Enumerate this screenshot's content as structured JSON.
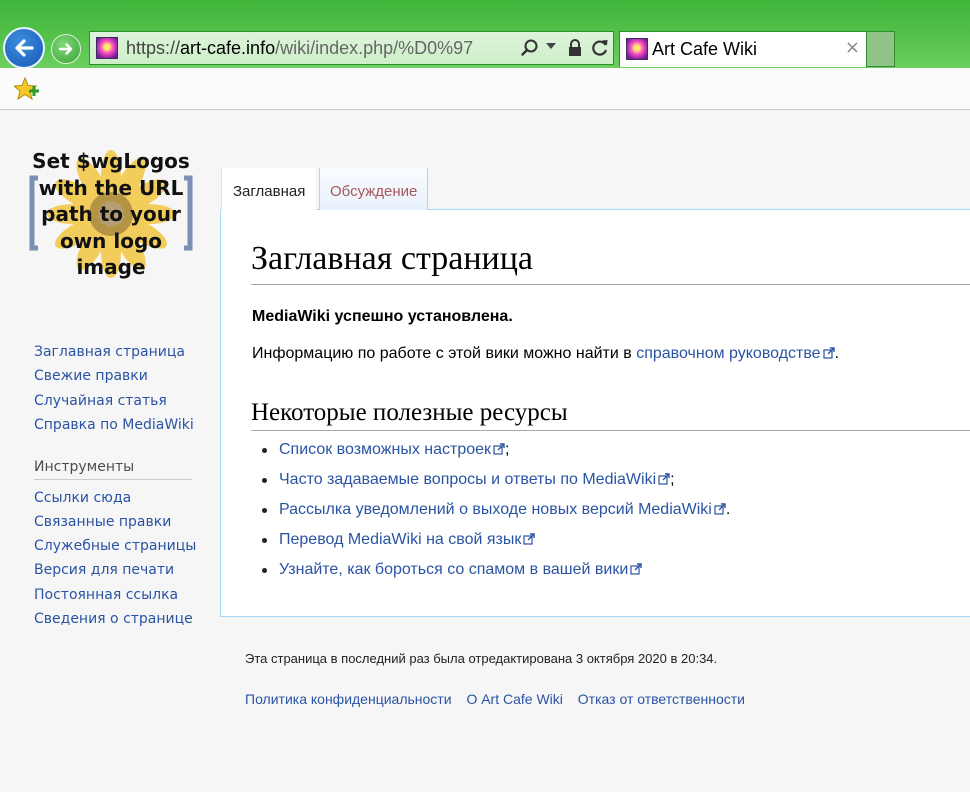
{
  "browser": {
    "url_prefix": "https://",
    "url_host": "art-cafe.info",
    "url_rest": "/wiki/index.php/%D0%97",
    "tab_title": "Art Cafe Wiki",
    "tab_close": "×",
    "accent": "#3fb53a"
  },
  "logo": {
    "lines": [
      "Set $wgLogos",
      "with the URL",
      "path to your",
      "own logo",
      "image"
    ]
  },
  "sidebar": {
    "navigation": [
      "Заглавная страница",
      "Свежие правки",
      "Случайная статья",
      "Справка по MediaWiki"
    ],
    "tools_heading": "Инструменты",
    "tools": [
      "Ссылки сюда",
      "Связанные правки",
      "Служебные страницы",
      "Версия для печати",
      "Постоянная ссылка",
      "Сведения о странице"
    ]
  },
  "tabs": {
    "main": "Заглавная",
    "talk": "Обсуждение"
  },
  "content": {
    "title": "Заглавная страница",
    "installed": "MediaWiki успешно установлена.",
    "info_prefix": "Информацию по работе с этой вики можно найти в ",
    "info_link": "справочном руководстве",
    "info_suffix": ".",
    "section_title": "Некоторые полезные ресурсы",
    "resources": [
      {
        "text": "Список возможных настроек",
        "suffix": ";"
      },
      {
        "text": "Часто задаваемые вопросы и ответы по MediaWiki",
        "suffix": ";"
      },
      {
        "text": "Рассылка уведомлений о выходе новых версий MediaWiki",
        "suffix": "."
      },
      {
        "text": "Перевод MediaWiki на свой язык",
        "suffix": ""
      },
      {
        "text": "Узнайте, как бороться со спамом в вашей вики",
        "suffix": ""
      }
    ]
  },
  "footer": {
    "last_edited": "Эта страница в последний раз была отредактирована 3 октября 2020 в 20:34.",
    "links": [
      "Политика конфиденциальности",
      "О Art Cafe Wiki",
      "Отказ от ответственности"
    ]
  }
}
